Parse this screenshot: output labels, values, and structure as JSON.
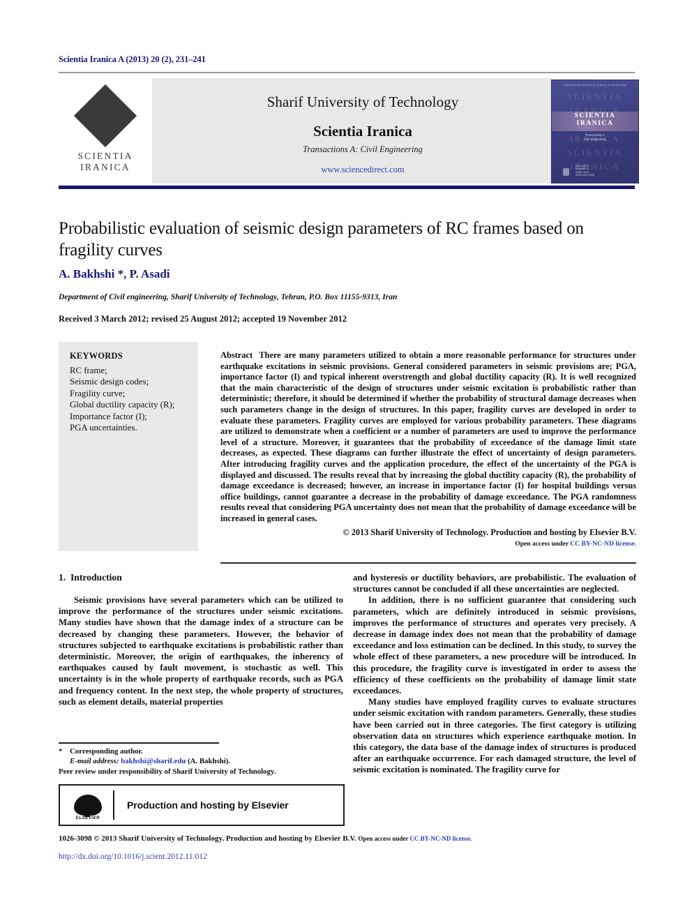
{
  "header": {
    "journal_reference": "Scientia Iranica A (2013) 20 (2), 231–241",
    "publisher_name": "Sharif University of Technology",
    "journal_name": "Scientia Iranica",
    "transactions": "Transactions A: Civil Engineering",
    "website": "www.sciencedirect.com",
    "logo_word_line1": "SCIENTIA",
    "logo_word_line2": "IRANICA",
    "cover": {
      "top_text": "International Journal of Science & Technology",
      "band_line1": "SCIENTIA",
      "band_line2": "IRANICA",
      "sub_line1": "Transactions A:",
      "sub_line2": "Civil Engineering",
      "watermark": "SCIENTIA IRANICA",
      "bottom_text": "VOLUME 20\nNUMBER 2\nAPRIL 2013\nISSN 1026-3098"
    }
  },
  "article": {
    "title": "Probabilistic evaluation of seismic design parameters of RC frames based on fragility curves",
    "authors": "A. Bakhshi *, P. Asadi",
    "affiliation": "Department of Civil engineering, Sharif University of Technology, Tehran, P.O. Box 11155-9313, Iran",
    "history": "Received 3 March 2012; revised 25 August 2012; accepted 19 November 2012"
  },
  "keywords": {
    "heading": "KEYWORDS",
    "items": [
      "RC frame;",
      "Seismic design codes;",
      "Fragility curve;",
      "Global ductility capacity (R);",
      "Importance factor (I);",
      "PGA uncertainties."
    ]
  },
  "abstract": {
    "label": "Abstract",
    "body": "There are many parameters utilized to obtain a more reasonable performance for structures under earthquake excitations in seismic provisions. General considered parameters in seismic provisions are; PGA, importance factor (I) and typical inherent overstrength and global ductility capacity (R). It is well recognized that the main characteristic of the design of structures under seismic excitation is probabilistic rather than deterministic; therefore, it should be determined if whether the probability of structural damage decreases when such parameters change in the design of structures. In this paper, fragility curves are developed in order to evaluate these parameters. Fragility curves are employed for various probability parameters. These diagrams are utilized to demonstrate when a coefficient or a number of parameters are used to improve the performance level of a structure. Moreover, it guarantees that the probability of exceedance of the damage limit state decreases, as expected. These diagrams can further illustrate the effect of uncertainty of design parameters. After introducing fragility curves and the application procedure, the effect of the uncertainty of the PGA is displayed and discussed. The results reveal that by increasing the global ductility capacity (R), the probability of damage exceedance is decreased; however, an increase in importance factor (I) for hospital buildings versus office buildings, cannot guarantee a decrease in the probability of damage exceedance. The PGA randomness results reveal that considering PGA uncertainty does not mean that the probability of damage exceedance will be increased in general cases.",
    "copyright": "© 2013 Sharif University of Technology. Production and hosting by Elsevier B.V.",
    "open_access_prefix": "Open access under ",
    "open_access_link": "CC BY-NC-ND license."
  },
  "body": {
    "section_number": "1.",
    "section_title": "Introduction",
    "left_paragraphs": [
      "Seismic provisions have several parameters which can be utilized to improve the performance of the structures under seismic excitations. Many studies have shown that the damage index of a structure can be decreased by changing these parameters. However, the behavior of structures subjected to earthquake excitations is probabilistic rather than deterministic. Moreover, the origin of earthquakes, the inherency of earthquakes caused by fault movement, is stochastic as well. This uncertainty is in the whole property of earthquake records, such as PGA and frequency content. In the next step, the whole property of structures, such as element details, material properties"
    ],
    "right_paragraphs": [
      "and hysteresis or ductility behaviors, are probabilistic. The evaluation of structures cannot be concluded if all these uncertainties are neglected.",
      "In addition, there is no sufficient guarantee that considering such parameters, which are definitely introduced in seismic provisions, improves the performance of structures and operates very precisely. A decrease in damage index does not mean that the probability of damage exceedance and loss estimation can be declined. In this study, to survey the whole effect of these parameters, a new procedure will be introduced. In this procedure, the fragility curve is investigated in order to assess the efficiency of these coefficients on the probability of damage limit state exceedances.",
      "Many studies have employed fragility curves to evaluate structures under seismic excitation with random parameters. Generally, these studies have been carried out in three categories. The first category is utilizing observation data on structures which experience earthquake motion. In this category, the data base of the damage index of  structures is produced after an earthquake occurrence. For each damaged structure, the level of seismic excitation is nominated. The fragility curve for"
    ]
  },
  "footnote": {
    "corresponding_marker": "*",
    "corresponding_text": "Corresponding author.",
    "email_label": "E-mail address:",
    "email": "bakhshi@sharif.edu",
    "email_suffix": "(A. Bakhshi).",
    "peer_review": "Peer review under responsibility of Sharif University of Technology.",
    "elsevier_banner": "Production and hosting by Elsevier",
    "elsevier_wordmark": "ELSEVIER"
  },
  "footer": {
    "issn_copyright": "1026-3098 © 2013 Sharif University of Technology. Production and hosting by Elsevier B.V. ",
    "open_access_prefix": "Open access under ",
    "open_access_link": "CC BY-NC-ND license.",
    "doi": "http://dx.doi.org/10.1016/j.scient.2012.11.012"
  },
  "colors": {
    "link": "#2a3fb0",
    "heading_navy": "#1a1a7a",
    "mast_rule": "#16166a",
    "keyword_bg": "#e9e9e9",
    "mast_bg": "#e8e8e8"
  }
}
